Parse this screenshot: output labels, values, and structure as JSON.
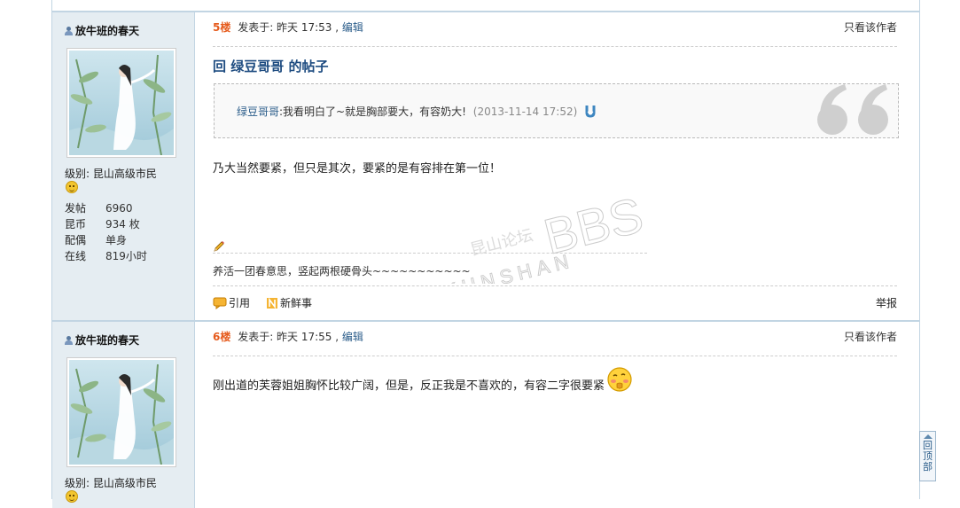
{
  "posts": [
    {
      "author": "放牛班的春天",
      "level": "级别: 昆山高级市民",
      "stats": [
        {
          "label": "发帖",
          "value": "6960"
        },
        {
          "label": "昆币",
          "value": "934 枚"
        },
        {
          "label": "配偶",
          "value": "单身"
        },
        {
          "label": "在线",
          "value": "819小时"
        }
      ],
      "floor": "5楼",
      "posted_at": "发表于: 昨天 17:53 ,",
      "edit_label": "编辑",
      "only_author": "只看该作者",
      "title": "回 绿豆哥哥 的帖子",
      "quote": {
        "author": "绿豆哥哥",
        "text": ":我看明白了~就是胸部要大，有容奶大!",
        "date": "(2013-11-14 17:52)"
      },
      "message": "乃大当然要紧，但只是其次，要紧的是有容排在第一位！",
      "signature": "养活一团春意思，竖起两根硬骨头~~~~~~~~~~~",
      "actions": {
        "cite": "引用",
        "fresh": "新鲜事",
        "report": "举报"
      }
    },
    {
      "author": "放牛班的春天",
      "level": "级别: 昆山高级市民",
      "floor": "6楼",
      "posted_at": "发表于: 昨天 17:55 ,",
      "edit_label": "编辑",
      "only_author": "只看该作者",
      "message": "刚出道的芙蓉姐姐胸怀比较广阔，但是，反正我是不喜欢的，有容二字很要紧"
    }
  ],
  "watermark": {
    "line1": "昆山论坛",
    "line2": "KUNSHAN",
    "brand": "BBS"
  },
  "back_to_top": "回顶部",
  "colors": {
    "accent": "#2b5d8a",
    "floor": "#e65c1e",
    "sidebar_bg": "#e5edf2",
    "border": "#c2d5e3"
  },
  "icons": [
    "user-icon",
    "avatar",
    "smiley-icon",
    "pencil-icon",
    "quote-mark-icon",
    "jump-to-quote-icon",
    "cite-icon",
    "fresh-icon",
    "blush-emoji-icon"
  ]
}
